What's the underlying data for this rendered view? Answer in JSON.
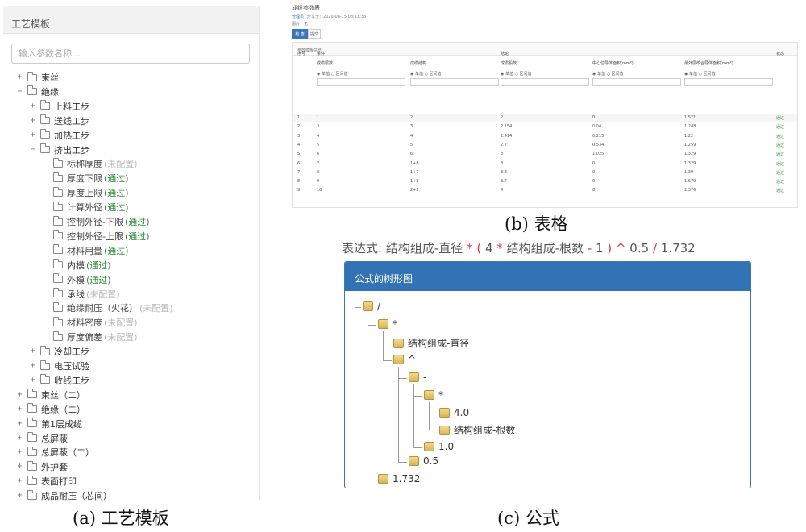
{
  "panel_a": {
    "header": "工艺模板",
    "search_placeholder": "输入参数名称...",
    "tree": [
      {
        "toggle": "+",
        "label": "束丝",
        "status": "",
        "st": ""
      },
      {
        "toggle": "−",
        "label": "绝缘",
        "status": "",
        "st": ""
      },
      {
        "toggle": "+",
        "label": "上料工步",
        "status": "",
        "st": ""
      },
      {
        "toggle": "+",
        "label": "送线工步",
        "status": "",
        "st": ""
      },
      {
        "toggle": "+",
        "label": "加热工步",
        "status": "",
        "st": ""
      },
      {
        "toggle": "−",
        "label": "挤出工步",
        "status": "",
        "st": ""
      },
      {
        "toggle": "",
        "label": "标称厚度",
        "status": "(未配置)",
        "st": "no"
      },
      {
        "toggle": "",
        "label": "厚度下限",
        "status": "(通过)",
        "st": "ok"
      },
      {
        "toggle": "",
        "label": "厚度上限",
        "status": "(通过)",
        "st": "ok"
      },
      {
        "toggle": "",
        "label": "计算外径",
        "status": "(通过)",
        "st": "ok"
      },
      {
        "toggle": "",
        "label": "控制外径-下限",
        "status": "(通过)",
        "st": "ok"
      },
      {
        "toggle": "",
        "label": "控制外径-上限",
        "status": "(通过)",
        "st": "ok"
      },
      {
        "toggle": "",
        "label": "材料用量",
        "status": "(通过)",
        "st": "ok"
      },
      {
        "toggle": "",
        "label": "内模",
        "status": "(通过)",
        "st": "ok"
      },
      {
        "toggle": "",
        "label": "外模",
        "status": "(通过)",
        "st": "ok"
      },
      {
        "toggle": "",
        "label": "承线",
        "status": "(未配置)",
        "st": "no"
      },
      {
        "toggle": "",
        "label": "绝缘耐压（火花）",
        "status": "(未配置)",
        "st": "no"
      },
      {
        "toggle": "",
        "label": "材料密度",
        "status": "(未配置)",
        "st": "no"
      },
      {
        "toggle": "",
        "label": "厚度偏差",
        "status": "(未配置)",
        "st": "no"
      },
      {
        "toggle": "+",
        "label": "冷却工步",
        "status": "",
        "st": ""
      },
      {
        "toggle": "+",
        "label": "电压试验",
        "status": "",
        "st": ""
      },
      {
        "toggle": "+",
        "label": "收线工步",
        "status": "",
        "st": ""
      },
      {
        "toggle": "+",
        "label": "束丝（二）",
        "status": "",
        "st": ""
      },
      {
        "toggle": "+",
        "label": "绝缘（二）",
        "status": "",
        "st": ""
      },
      {
        "toggle": "+",
        "label": "第1层成缆",
        "status": "",
        "st": ""
      },
      {
        "toggle": "+",
        "label": "总屏蔽",
        "status": "",
        "st": ""
      },
      {
        "toggle": "+",
        "label": "总屏蔽（二）",
        "status": "",
        "st": ""
      },
      {
        "toggle": "+",
        "label": "外护套",
        "status": "",
        "st": ""
      },
      {
        "toggle": "+",
        "label": "表面打印",
        "status": "",
        "st": ""
      },
      {
        "toggle": "+",
        "label": "成品耐压（芯间）",
        "status": "",
        "st": ""
      }
    ]
  },
  "panel_b": {
    "title": "成缆参数表",
    "meta_link": "管理员",
    "meta_text": "分享于：2020-08-15 08:11:33",
    "picture_label": "图片：",
    "picture_link": "无",
    "tab_check": "检 查",
    "tab_submit": "提交",
    "panel_header": "参数模板总览",
    "col_index": "序号",
    "col_condition": "条件",
    "col_result": "结论",
    "col_status": "状态",
    "sub_headers": [
      "成缆层数",
      "成缆结构",
      "成缆股数",
      "中心位导体面积(mm²)",
      "最外层绞合导体面积(mm²)"
    ],
    "radio_single": "单值",
    "radio_range": "区间值",
    "rows": [
      [
        "1",
        "1",
        "2",
        "2",
        "0",
        "1.571",
        "通过"
      ],
      [
        "2",
        "3",
        "3",
        "2.154",
        "0.04",
        "1.248",
        "通过"
      ],
      [
        "3",
        "4",
        "4",
        "2.414",
        "0.215",
        "1.22",
        "通过"
      ],
      [
        "4",
        "5",
        "5",
        "2.7",
        "0.534",
        "1.259",
        "通过"
      ],
      [
        "5",
        "6",
        "6",
        "3",
        "1.025",
        "1.329",
        "通过"
      ],
      [
        "6",
        "7",
        "1+6",
        "3",
        "0",
        "1.329",
        "通过"
      ],
      [
        "7",
        "8",
        "1+7",
        "3.3",
        "0",
        "1.39",
        "通过"
      ],
      [
        "8",
        "9",
        "1+8",
        "3.7",
        "0",
        "1.679",
        "通过"
      ],
      [
        "9",
        "10",
        "2+8",
        "4",
        "0",
        "2.376",
        "通过"
      ]
    ]
  },
  "panel_c": {
    "expr_prefix": "表达式: 结构组成-直径",
    "expr_tail": "结构组成-根数",
    "expr_4": "4",
    "expr_1": "1",
    "expr_05": "0.5",
    "expr_1732": "1.732",
    "op_mul": "*",
    "op_lpar": "(",
    "op_mul2": "*",
    "op_minus": "-",
    "op_rpar": ")",
    "op_pow": "^",
    "op_div": "/",
    "title": "公式的树形图",
    "nodes": [
      {
        "label": "/",
        "depth": 0
      },
      {
        "label": "*",
        "depth": 1
      },
      {
        "label": "结构组成-直径",
        "depth": 2
      },
      {
        "label": "^",
        "depth": 2
      },
      {
        "label": "-",
        "depth": 3
      },
      {
        "label": "*",
        "depth": 4
      },
      {
        "label": "4.0",
        "depth": 5
      },
      {
        "label": "结构组成-根数",
        "depth": 5
      },
      {
        "label": "1.0",
        "depth": 4
      },
      {
        "label": "0.5",
        "depth": 3
      },
      {
        "label": "1.732",
        "depth": 1
      }
    ]
  },
  "captions": {
    "a": "(a)  工艺模板",
    "b": "(b)  表格",
    "c": "(c)  公式"
  }
}
